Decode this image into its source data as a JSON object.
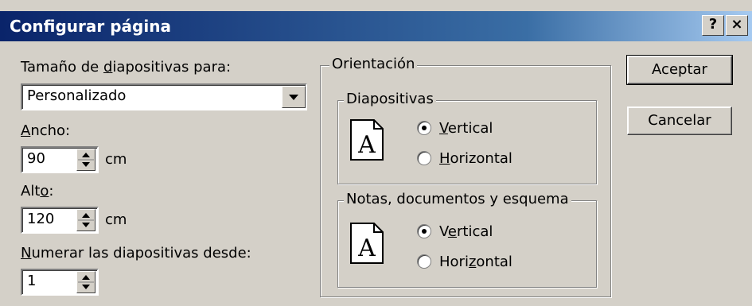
{
  "window": {
    "title": "Configurar página",
    "help_label": "?",
    "close_label": "×"
  },
  "left": {
    "size_label_pre": "Tamaño de ",
    "size_label_key": "d",
    "size_label_post": "iapositivas para:",
    "size_value": "Personalizado",
    "width_key": "A",
    "width_rest": "ncho:",
    "width_value": "90",
    "width_unit": "cm",
    "height_pre": "Alt",
    "height_key": "o",
    "height_post": ":",
    "height_value": "120",
    "height_unit": "cm",
    "number_key": "N",
    "number_rest": "umerar las diapositivas desde:",
    "number_value": "1"
  },
  "orientation": {
    "title": "Orientación",
    "slides": {
      "title": "Diapositivas",
      "vertical_key": "V",
      "vertical_rest": "ertical",
      "horizontal_key": "H",
      "horizontal_rest": "orizontal",
      "selected": "vertical",
      "icon_letter": "A"
    },
    "notes": {
      "title": "Notas, documentos y esquema",
      "vertical_pre": "V",
      "vertical_key": "e",
      "vertical_post": "rtical",
      "horizontal_pre": "Hori",
      "horizontal_key": "z",
      "horizontal_post": "ontal",
      "selected": "vertical",
      "icon_letter": "A"
    }
  },
  "buttons": {
    "ok": "Aceptar",
    "cancel": "Cancelar"
  },
  "colors": {
    "title_bar_start": "#0a246a",
    "title_bar_end": "#a6caf0",
    "dialog_bg": "#d4d0c8"
  }
}
